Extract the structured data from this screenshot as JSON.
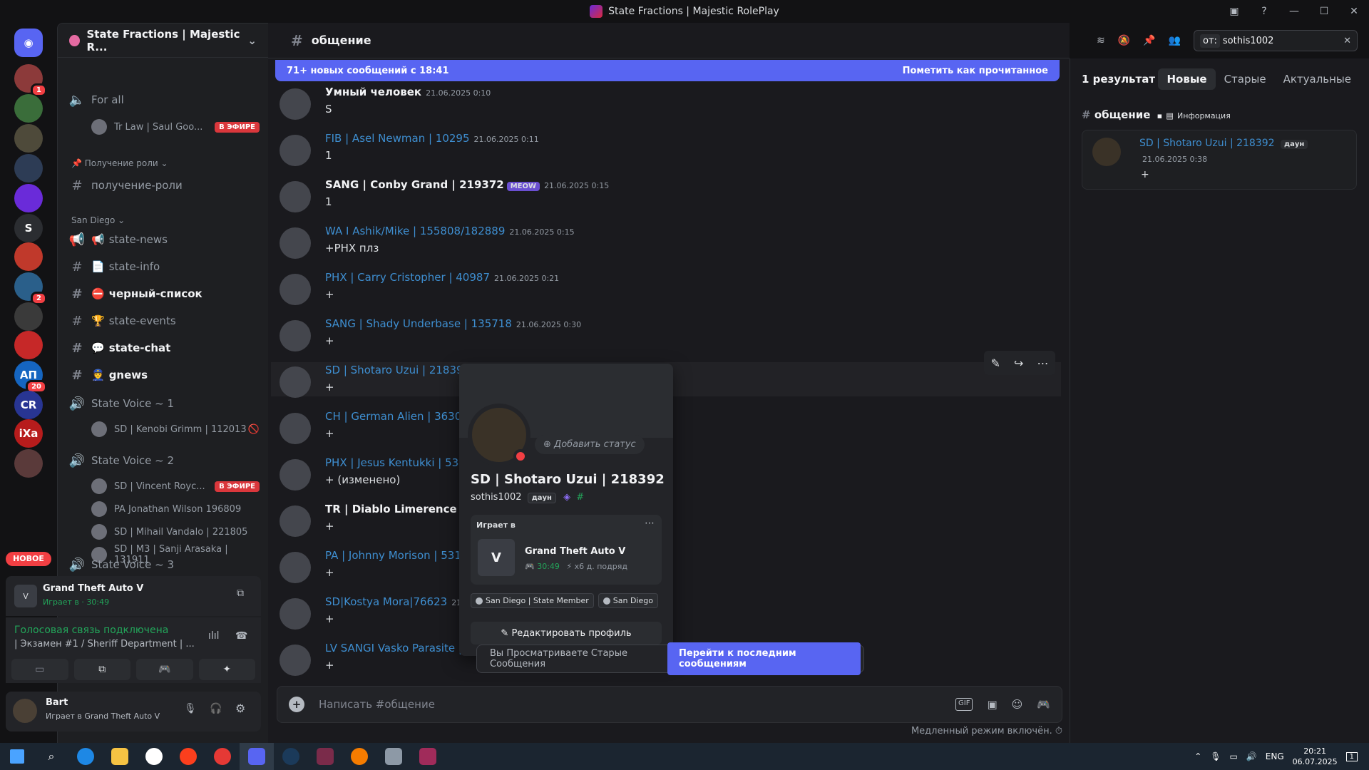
{
  "window": {
    "title": "State Fractions | Majestic RolePlay"
  },
  "servers": {
    "items": [
      {
        "label": "",
        "color": "#5865f2",
        "badge": ""
      },
      {
        "label": "",
        "color": "#8c3a3a",
        "badge": "1"
      },
      {
        "label": "",
        "color": "#3a6d3a",
        "badge": ""
      },
      {
        "label": "",
        "color": "#4e4a3a",
        "badge": ""
      },
      {
        "label": "",
        "color": "#2d3c55",
        "badge": ""
      },
      {
        "label": "",
        "color": "#6a2bd9",
        "badge": ""
      },
      {
        "label": "S",
        "color": "#2b2d31",
        "badge": ""
      },
      {
        "label": "",
        "color": "#c0392b",
        "badge": ""
      },
      {
        "label": "",
        "color": "#2a5f8a",
        "badge": "2"
      },
      {
        "label": "",
        "color": "#3a3a3a",
        "badge": ""
      },
      {
        "label": "",
        "color": "#c62828",
        "badge": ""
      },
      {
        "label": "АП",
        "color": "#1565c0",
        "badge": "20"
      },
      {
        "label": "CR",
        "color": "#283593",
        "badge": ""
      },
      {
        "label": "iXa",
        "color": "#b71c1c",
        "badge": ""
      },
      {
        "label": "",
        "color": "#5a3a3a",
        "badge": ""
      }
    ],
    "new_label": "НОВОЕ"
  },
  "sidebar": {
    "guild_name": "State Fractions | Majestic R...",
    "voice_for_all": "For all",
    "voice_for_all_user": "Tr Law | Saul Goo...",
    "live_label": "В ЭФИРЕ",
    "cat_roles": "Получение роли",
    "ch_roles": "получение-роли",
    "cat_sandiego": "San Diego",
    "channels": [
      {
        "name": "state-news",
        "glyph": "📢",
        "bold": false
      },
      {
        "name": "state-info",
        "glyph": "📄",
        "bold": false
      },
      {
        "name": "черный-список",
        "glyph": "⛔",
        "bold": true
      },
      {
        "name": "state-events",
        "glyph": "🏆",
        "bold": false
      },
      {
        "name": "state-chat",
        "glyph": "💬",
        "bold": true
      },
      {
        "name": "gnews",
        "glyph": "👮",
        "bold": true
      }
    ],
    "voice1": "State Voice ~ 1",
    "voice1_user": "SD | Kenobi Grimm | 112013",
    "voice2": "State Voice ~ 2",
    "voice2_users": [
      "SD | Vincent Royc...",
      "PA Jonathan Wilson 196809",
      "SD | Mihail Vandalo | 221805",
      "SD | M3 | Sanji Arasaka | 131911"
    ],
    "voice3": "State Voice ~ 3"
  },
  "activity": {
    "game": "Grand Theft Auto V",
    "sub": "Играет в · 30:49"
  },
  "voice_panel": {
    "status": "Голосовая связь подключена",
    "channel": "| Экзамен #1 / Sheriff Department | ..."
  },
  "user_panel": {
    "name": "Bart",
    "status": "Играет в Grand Theft Auto V"
  },
  "channel": {
    "name": "общение"
  },
  "new_bar": {
    "left": "71+ новых сообщений с 18:41",
    "right": "Пометить как прочитанное"
  },
  "messages": [
    {
      "name": "Умный человек",
      "blue": false,
      "tag": "",
      "time": "21.06.2025 0:10",
      "text": "S"
    },
    {
      "name": "FIB | Asel Newman  | 10295",
      "blue": true,
      "tag": "",
      "time": "21.06.2025 0:11",
      "text": "1"
    },
    {
      "name": "SANG | Conby Grand | 219372",
      "blue": false,
      "tag": "MEOW",
      "time": "21.06.2025 0:15",
      "text": "1"
    },
    {
      "name": "WA I Ashik/Mike | 155808/182889",
      "blue": true,
      "tag": "",
      "time": "21.06.2025 0:15",
      "text": "+РНХ плз"
    },
    {
      "name": "PHX | Carry Cristopher | 40987",
      "blue": true,
      "tag": "",
      "time": "21.06.2025 0:21",
      "text": "+"
    },
    {
      "name": "SANG | Shady Underbase | 135718",
      "blue": true,
      "tag": "",
      "time": "21.06.2025 0:30",
      "text": "+"
    },
    {
      "name": "SD | Shotaro Uzui | 218392",
      "blue": true,
      "tag": "",
      "time": "",
      "text": "+"
    },
    {
      "name": "CH | German Alien | 363011",
      "blue": true,
      "tag": "",
      "time": "",
      "text": "+"
    },
    {
      "name": "PHX | Jesus Kentukki | 5342",
      "blue": true,
      "tag": "",
      "time": "",
      "text": "+ (изменено)"
    },
    {
      "name": "TR | Diablo Limerence |2241",
      "blue": false,
      "tag": "",
      "time": "",
      "text": "+"
    },
    {
      "name": "PA | Johnny Morison | 53187",
      "blue": true,
      "tag": "",
      "time": "",
      "text": "+"
    },
    {
      "name": "SD|Kostya Mora|76623",
      "blue": true,
      "tag": "",
      "time": "21.0",
      "text": "+"
    },
    {
      "name": "LV SANGI Vasko Parasite | 1",
      "blue": true,
      "tag": "",
      "time": "",
      "text": "+"
    }
  ],
  "profile": {
    "add_status": "Добавить статус",
    "name": "SD | Shotaro Uzui | 218392",
    "username": "sothis1002",
    "tag": "даун",
    "playing_label": "Играет в",
    "game": "Grand Theft Auto V",
    "time": "30:49",
    "streak": "x6 д. подряд",
    "roles": [
      "San Diego | State Member",
      "San Diego"
    ],
    "edit": "Редактировать профиль"
  },
  "jump": {
    "text": "Вы Просматриваете Старые Сообщения",
    "button": "Перейти к последним сообщениям"
  },
  "composer": {
    "placeholder": "Написать #общение",
    "gif": "GIF"
  },
  "slowmode": "Медленный режим включён.",
  "search": {
    "chip": "от:",
    "query": "sothis1002"
  },
  "results": {
    "count": "1 результат",
    "tabs": [
      "Новые",
      "Старые",
      "Актуальные"
    ],
    "channel": "общение",
    "category": "Информация",
    "author": "SD | Shotaro Uzui | 218392",
    "tag": "даун",
    "time": "21.06.2025 0:38",
    "text": "+"
  },
  "tray": {
    "lang": "ENG",
    "time": "20:21",
    "date": "06.07.2025",
    "notif": "1"
  }
}
